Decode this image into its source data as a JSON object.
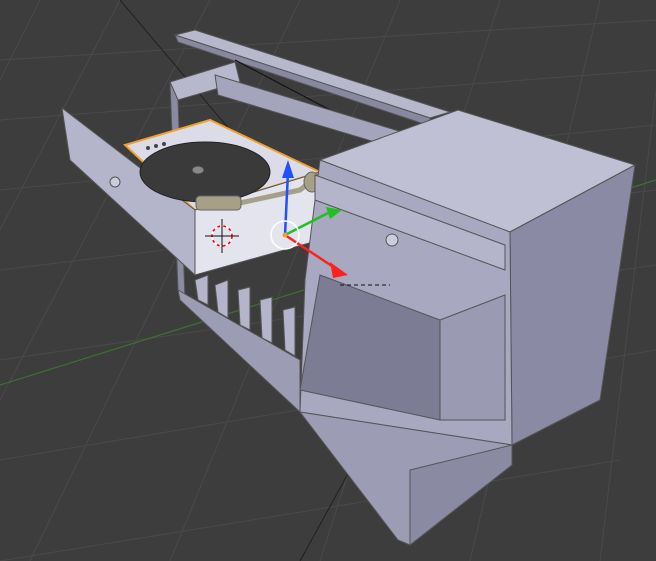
{
  "viewport": {
    "name": "3D Viewport",
    "background_color": "#3d3d3d",
    "grid_color": "#4a4a4a",
    "x_axis_color": "#8a3c3c",
    "y_axis_color": "#4c8a3c"
  },
  "scene_object": {
    "name": "record-player-cabinet",
    "body_color": "#a8a8c0",
    "shadow_color": "#6e6e86",
    "platter_color": "#3a3a3a",
    "tonearm_color": "#a6a086",
    "selection_outline_color": "#f0a030"
  },
  "gizmo": {
    "z_color": "#2050ff",
    "y_color": "#20c020",
    "x_color": "#ff2020",
    "pivot_color": "#ffffff"
  },
  "cursor_3d": {
    "ring_color_a": "#ff0000",
    "ring_color_b": "#ffffff"
  }
}
